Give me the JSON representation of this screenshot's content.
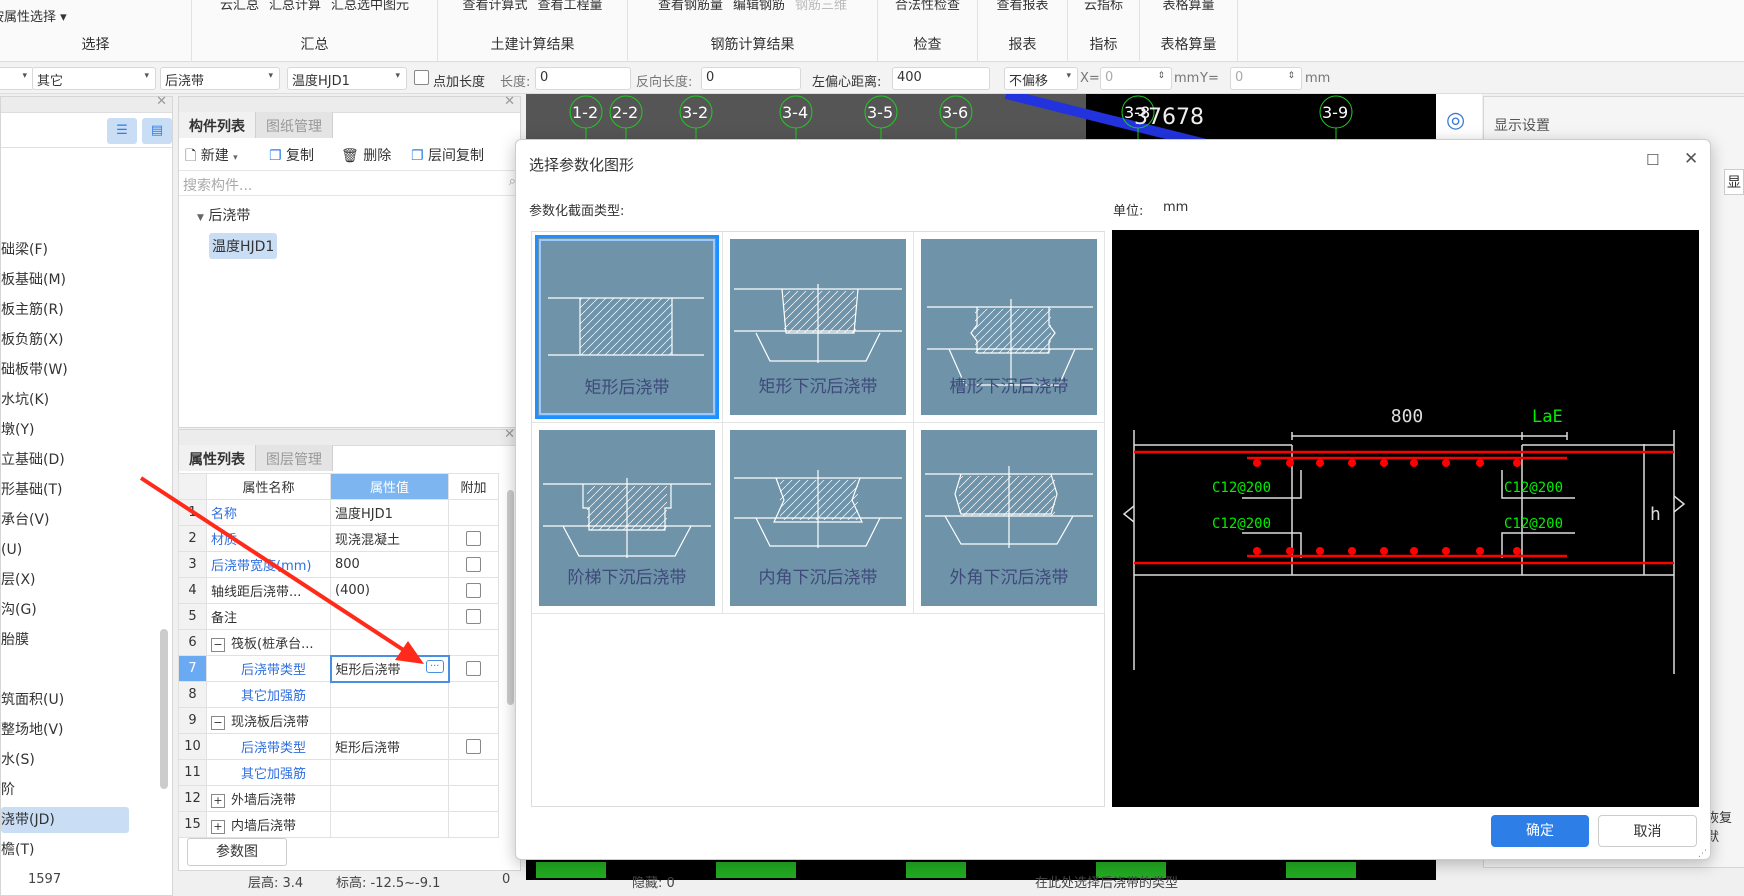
{
  "ribbon": {
    "groups": [
      {
        "label": "选择",
        "cmds": [
          "按属性选择 ▾"
        ]
      },
      {
        "label": "汇总",
        "cmds": [
          "云汇总",
          "汇总计算",
          "汇总选中图元"
        ]
      },
      {
        "label": "土建计算结果",
        "cmds": [
          "查看计算式",
          "查看工程量"
        ]
      },
      {
        "label": "钢筋计算结果",
        "cmds": [
          "查看钢筋量",
          "编辑钢筋",
          "钢筋三维"
        ]
      },
      {
        "label": "检查",
        "cmds": [
          "合法性检查"
        ]
      },
      {
        "label": "报表",
        "cmds": [
          "查看报表"
        ]
      },
      {
        "label": "指标",
        "cmds": [
          "云指标"
        ]
      },
      {
        "label": "表格算量",
        "cmds": [
          "表格算量"
        ]
      }
    ]
  },
  "toolbar": {
    "category": "其它",
    "type": "后浇带",
    "component": "温度HJD1",
    "point_length_label": "点加长度",
    "length_label": "长度:",
    "length": "0",
    "reverse_length_label": "反向长度:",
    "reverse_length": "0",
    "left_offset_label": "左偏心距离:",
    "left_offset": "400",
    "offset_mode": "不偏移",
    "x_label": "X=",
    "x": "0",
    "unit1": "mm",
    "y_label": "Y=",
    "y": "0",
    "unit2": "mm"
  },
  "left_nav": {
    "items": [
      "础梁(F)",
      "板基础(M)",
      "板主筋(R)",
      "板负筋(X)",
      "础板带(W)",
      "水坑(K)",
      "墩(Y)",
      "立基础(D)",
      "形基础(T)",
      "承台(V)",
      "(U)",
      "层(X)",
      "沟(G)",
      "胎膜",
      "",
      "筑面积(U)",
      "整场地(V)",
      "水(S)",
      "阶",
      "浇带(JD)",
      "檐(T)"
    ],
    "selected": "浇带(JD)"
  },
  "component_panel": {
    "tabs": [
      "构件列表",
      "图纸管理"
    ],
    "actions": [
      "新建",
      "复制",
      "删除",
      "层间复制"
    ],
    "search_placeholder": "搜索构件...",
    "tree": {
      "group": "后浇带",
      "item": "温度HJD1"
    }
  },
  "property_panel": {
    "tabs": [
      "属性列表",
      "图层管理"
    ],
    "headers": [
      "属性名称",
      "属性值",
      "附加"
    ],
    "rows": [
      {
        "n": "1",
        "name": "名称",
        "value": "温度HJD1",
        "blue": true,
        "cb": false,
        "indent": 0
      },
      {
        "n": "2",
        "name": "材质",
        "value": "现浇混凝土",
        "blue": true,
        "cb": true,
        "indent": 0
      },
      {
        "n": "3",
        "name": "后浇带宽度(mm)",
        "value": "800",
        "blue": true,
        "cb": true,
        "indent": 0
      },
      {
        "n": "4",
        "name": "轴线距后浇带...",
        "value": "(400)",
        "blue": false,
        "cb": true,
        "indent": 0
      },
      {
        "n": "5",
        "name": "备注",
        "value": "",
        "blue": false,
        "cb": true,
        "indent": 0
      },
      {
        "n": "6",
        "name": "筏板(桩承台...",
        "value": "",
        "blue": false,
        "cb": false,
        "indent": 0,
        "toggle": "−"
      },
      {
        "n": "7",
        "name": "后浇带类型",
        "value": "矩形后浇带",
        "blue": true,
        "cb": true,
        "indent": 1,
        "selected": true
      },
      {
        "n": "8",
        "name": "其它加强筋",
        "value": "",
        "blue": true,
        "cb": false,
        "indent": 1
      },
      {
        "n": "9",
        "name": "现浇板后浇带",
        "value": "",
        "blue": false,
        "cb": false,
        "indent": 0,
        "toggle": "−"
      },
      {
        "n": "10",
        "name": "后浇带类型",
        "value": "矩形后浇带",
        "blue": true,
        "cb": true,
        "indent": 1
      },
      {
        "n": "11",
        "name": "其它加强筋",
        "value": "",
        "blue": true,
        "cb": false,
        "indent": 1
      },
      {
        "n": "12",
        "name": "外墙后浇带",
        "value": "",
        "blue": false,
        "cb": false,
        "indent": 0,
        "toggle": "+"
      },
      {
        "n": "15",
        "name": "内墙后浇带",
        "value": "",
        "blue": false,
        "cb": false,
        "indent": 0,
        "toggle": "+"
      }
    ],
    "param_button": "参数图"
  },
  "cad_axes": [
    "1-2",
    "2-2",
    "3-2",
    "3-4",
    "3-5",
    "3-6",
    "3-8",
    "3-9"
  ],
  "cad_number": "37678",
  "right_panel": {
    "title": "显示设置",
    "partial": "显",
    "restore": "恢复默"
  },
  "dialog": {
    "title": "选择参数化图形",
    "section_label": "参数化截面类型:",
    "unit_label": "单位:",
    "unit": "mm",
    "shapes": [
      "矩形后浇带",
      "矩形下沉后浇带",
      "槽形下沉后浇带",
      "阶梯下沉后浇带",
      "内角下沉后浇带",
      "外角下沉后浇带"
    ],
    "selected_index": 0,
    "preview": {
      "width": "800",
      "anchor": "LaE",
      "height": "h",
      "rebar": [
        "C12@200",
        "C12@200",
        "C12@200",
        "C12@200"
      ]
    },
    "ok": "确定",
    "cancel": "取消"
  },
  "status": {
    "count": "1597",
    "floor_height": "层高: 3.4",
    "elevation": "标高: -12.5~-9.1",
    "value": "0",
    "hidden": "隐藏: 0",
    "hint": "在此处选择后浇带的类型"
  },
  "colors": {
    "accent": "#2d7ee6",
    "thumb_bg": "#6f93a9",
    "rebar": "#ff0000",
    "label_green": "#00ee00"
  }
}
